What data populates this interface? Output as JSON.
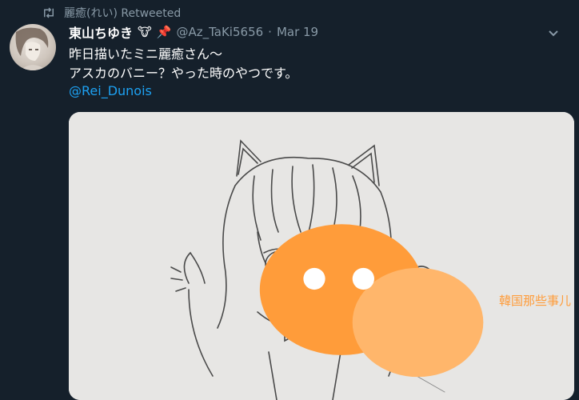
{
  "retweet": {
    "icon": "retweet-icon",
    "label": "麗癒(れい) Retweeted"
  },
  "tweet": {
    "author": {
      "display_name": "東山ちゆき",
      "emoji_1": "🐮",
      "emoji_2": "📌",
      "handle": "@Az_TaKi5656",
      "separator": "·",
      "date": "Mar 19"
    },
    "text_lines": [
      "昨日描いたミニ麗癒さん〜",
      "アスカのバニー？やった時のやつです。"
    ],
    "mention": "@Rei_Dunois"
  },
  "media": {
    "description_icon": "sketch-image"
  },
  "watermark": {
    "text": "韓国那些事儿"
  },
  "colors": {
    "background": "#15202b",
    "secondary_text": "#8899a6",
    "link": "#1da1f2",
    "paper": "#e7e6e4"
  }
}
